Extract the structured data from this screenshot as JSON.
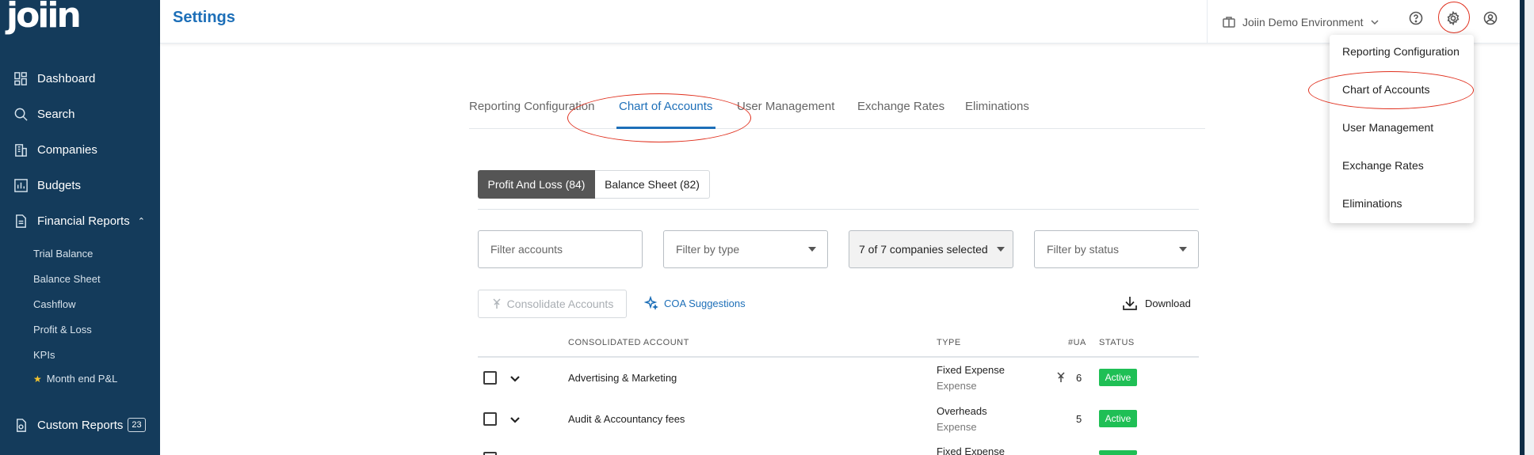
{
  "app": {
    "logo_text": "joiin",
    "page_title": "Settings"
  },
  "sidebar": {
    "items": [
      {
        "label": "Dashboard",
        "icon": "dashboard-icon"
      },
      {
        "label": "Search",
        "icon": "search-icon"
      },
      {
        "label": "Companies",
        "icon": "companies-icon"
      },
      {
        "label": "Budgets",
        "icon": "budgets-icon"
      },
      {
        "label": "Financial Reports",
        "icon": "financial-reports-icon"
      }
    ],
    "financial_reports_sub": [
      "Trial Balance",
      "Balance Sheet",
      "Cashflow",
      "Profit & Loss",
      "KPIs",
      "Month end P&L"
    ],
    "custom_reports": {
      "label": "Custom Reports",
      "count": "23"
    }
  },
  "topbar": {
    "environment": "Joiin Demo Environment"
  },
  "settings_menu": {
    "items": [
      "Reporting Configuration",
      "Chart of Accounts",
      "User Management",
      "Exchange Rates",
      "Eliminations"
    ]
  },
  "tabs": [
    "Reporting Configuration",
    "Chart of Accounts",
    "User Management",
    "Exchange Rates",
    "Eliminations"
  ],
  "active_tab": "Chart of Accounts",
  "segments": {
    "pl": "Profit And Loss (84)",
    "bs": "Balance Sheet (82)"
  },
  "filters": {
    "accounts_placeholder": "Filter accounts",
    "type_placeholder": "Filter by type",
    "companies_value": "7 of 7 companies selected",
    "status_placeholder": "Filter by status"
  },
  "actions": {
    "consolidate": "Consolidate Accounts",
    "coa_suggestions": "COA Suggestions",
    "download": "Download"
  },
  "table": {
    "headers": {
      "account": "CONSOLIDATED ACCOUNT",
      "type": "TYPE",
      "ua": "#UA",
      "status": "STATUS"
    },
    "rows": [
      {
        "account": "Advertising & Marketing",
        "type": "Fixed Expense",
        "subtype": "Expense",
        "ua": "6",
        "status": "Active"
      },
      {
        "account": "Audit & Accountancy fees",
        "type": "Overheads",
        "subtype": "Expense",
        "ua": "5",
        "status": "Active"
      },
      {
        "account": "",
        "type": "Fixed Expense",
        "subtype": "",
        "ua": "",
        "status": ""
      }
    ]
  },
  "colors": {
    "sidebar_bg": "#143b5b",
    "accent": "#1d6fb8",
    "active_green": "#1fbf55",
    "annotation_red": "#e0301e"
  }
}
